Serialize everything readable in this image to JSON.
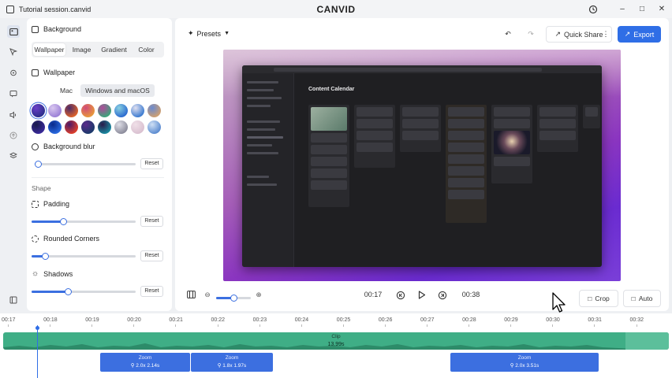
{
  "window": {
    "title": "Tutorial session.canvid",
    "brand": "CANVID",
    "controls": [
      "minimize",
      "maximize",
      "close"
    ]
  },
  "rail": {
    "items": [
      {
        "icon": "background-icon",
        "active": true
      },
      {
        "icon": "cursor-icon"
      },
      {
        "icon": "webcam-icon"
      },
      {
        "icon": "caption-icon"
      },
      {
        "icon": "audio-icon"
      },
      {
        "icon": "upload-icon"
      },
      {
        "icon": "layers-icon"
      },
      {
        "icon": "collapse-panel-icon"
      }
    ]
  },
  "panel": {
    "section_title": "Background",
    "tabs": [
      "Wallpaper",
      "Image",
      "Gradient",
      "Color"
    ],
    "active_tab": "Wallpaper",
    "wallpaper_heading": "Wallpaper",
    "os_tabs": [
      "Mac",
      "Windows and macOS"
    ],
    "active_os_tab": "Windows and macOS",
    "swatch_colors": [
      [
        "#2b2f8a",
        "#6a3fc7"
      ],
      [
        "#9a7fd6",
        "#d9c7f0"
      ],
      [
        "#e0642a",
        "#4a2a6a"
      ],
      [
        "#e89a3a",
        "#d04a7a"
      ],
      [
        "#3aa67a",
        "#b04a9a"
      ],
      [
        "#2a6ad0",
        "#8ad0e0"
      ],
      [
        "#3a7ad0",
        "#e0e0f0"
      ],
      [
        "#d0a070",
        "#6a8ad0"
      ],
      [
        "#3a2a9a",
        "#1a1a4a"
      ],
      [
        "#2a6ae0",
        "#0a2a8a"
      ],
      [
        "#e0402a",
        "#4a1a6a"
      ],
      [
        "#1a3a6a",
        "#5a2a8a"
      ],
      [
        "#1a8aa0",
        "#2a1a4a"
      ],
      [
        "#8a8a9a",
        "#e0e0e8"
      ],
      [
        "#d9c0d0",
        "#f0e0e8"
      ],
      [
        "#5a8ad0",
        "#cfe0f5"
      ]
    ],
    "selected_swatch": 0,
    "blur_label": "Background blur",
    "blur_value": 0.03,
    "shape_label": "Shape",
    "padding_label": "Padding",
    "padding_value": 0.3,
    "corners_label": "Rounded Corners",
    "corners_value": 0.13,
    "shadows_label": "Shadows",
    "shadows_value": 0.35,
    "reset_label": "Reset"
  },
  "toolbar": {
    "presets_label": "Presets",
    "quick_share_label": "Quick Share",
    "export_label": "Export"
  },
  "preview": {
    "calendar_title": "Content Calendar"
  },
  "controls": {
    "zoom_value": 0.5,
    "current_time": "00:17",
    "total_time": "00:38",
    "crop_label": "Crop",
    "auto_label": "Auto"
  },
  "timeline": {
    "ruler": [
      "00:17",
      "00:18",
      "00:19",
      "00:20",
      "00:21",
      "00:22",
      "00:23",
      "00:24",
      "00:25",
      "00:26",
      "00:27",
      "00:28",
      "00:29",
      "00:30",
      "00:31",
      "00:32"
    ],
    "clip_label": "Clip",
    "clip_duration": "13.99s",
    "zooms": [
      {
        "label": "Zoom",
        "value": "2.0x  2.14s"
      },
      {
        "label": "Zoom",
        "value": "1.8x  1.97s"
      },
      {
        "label": "Zoom",
        "value": "2.0x  3.51s"
      }
    ]
  },
  "colors": {
    "accent": "#2f6ee6",
    "clip": "#3fae86",
    "zoom": "#3c6fe0"
  }
}
